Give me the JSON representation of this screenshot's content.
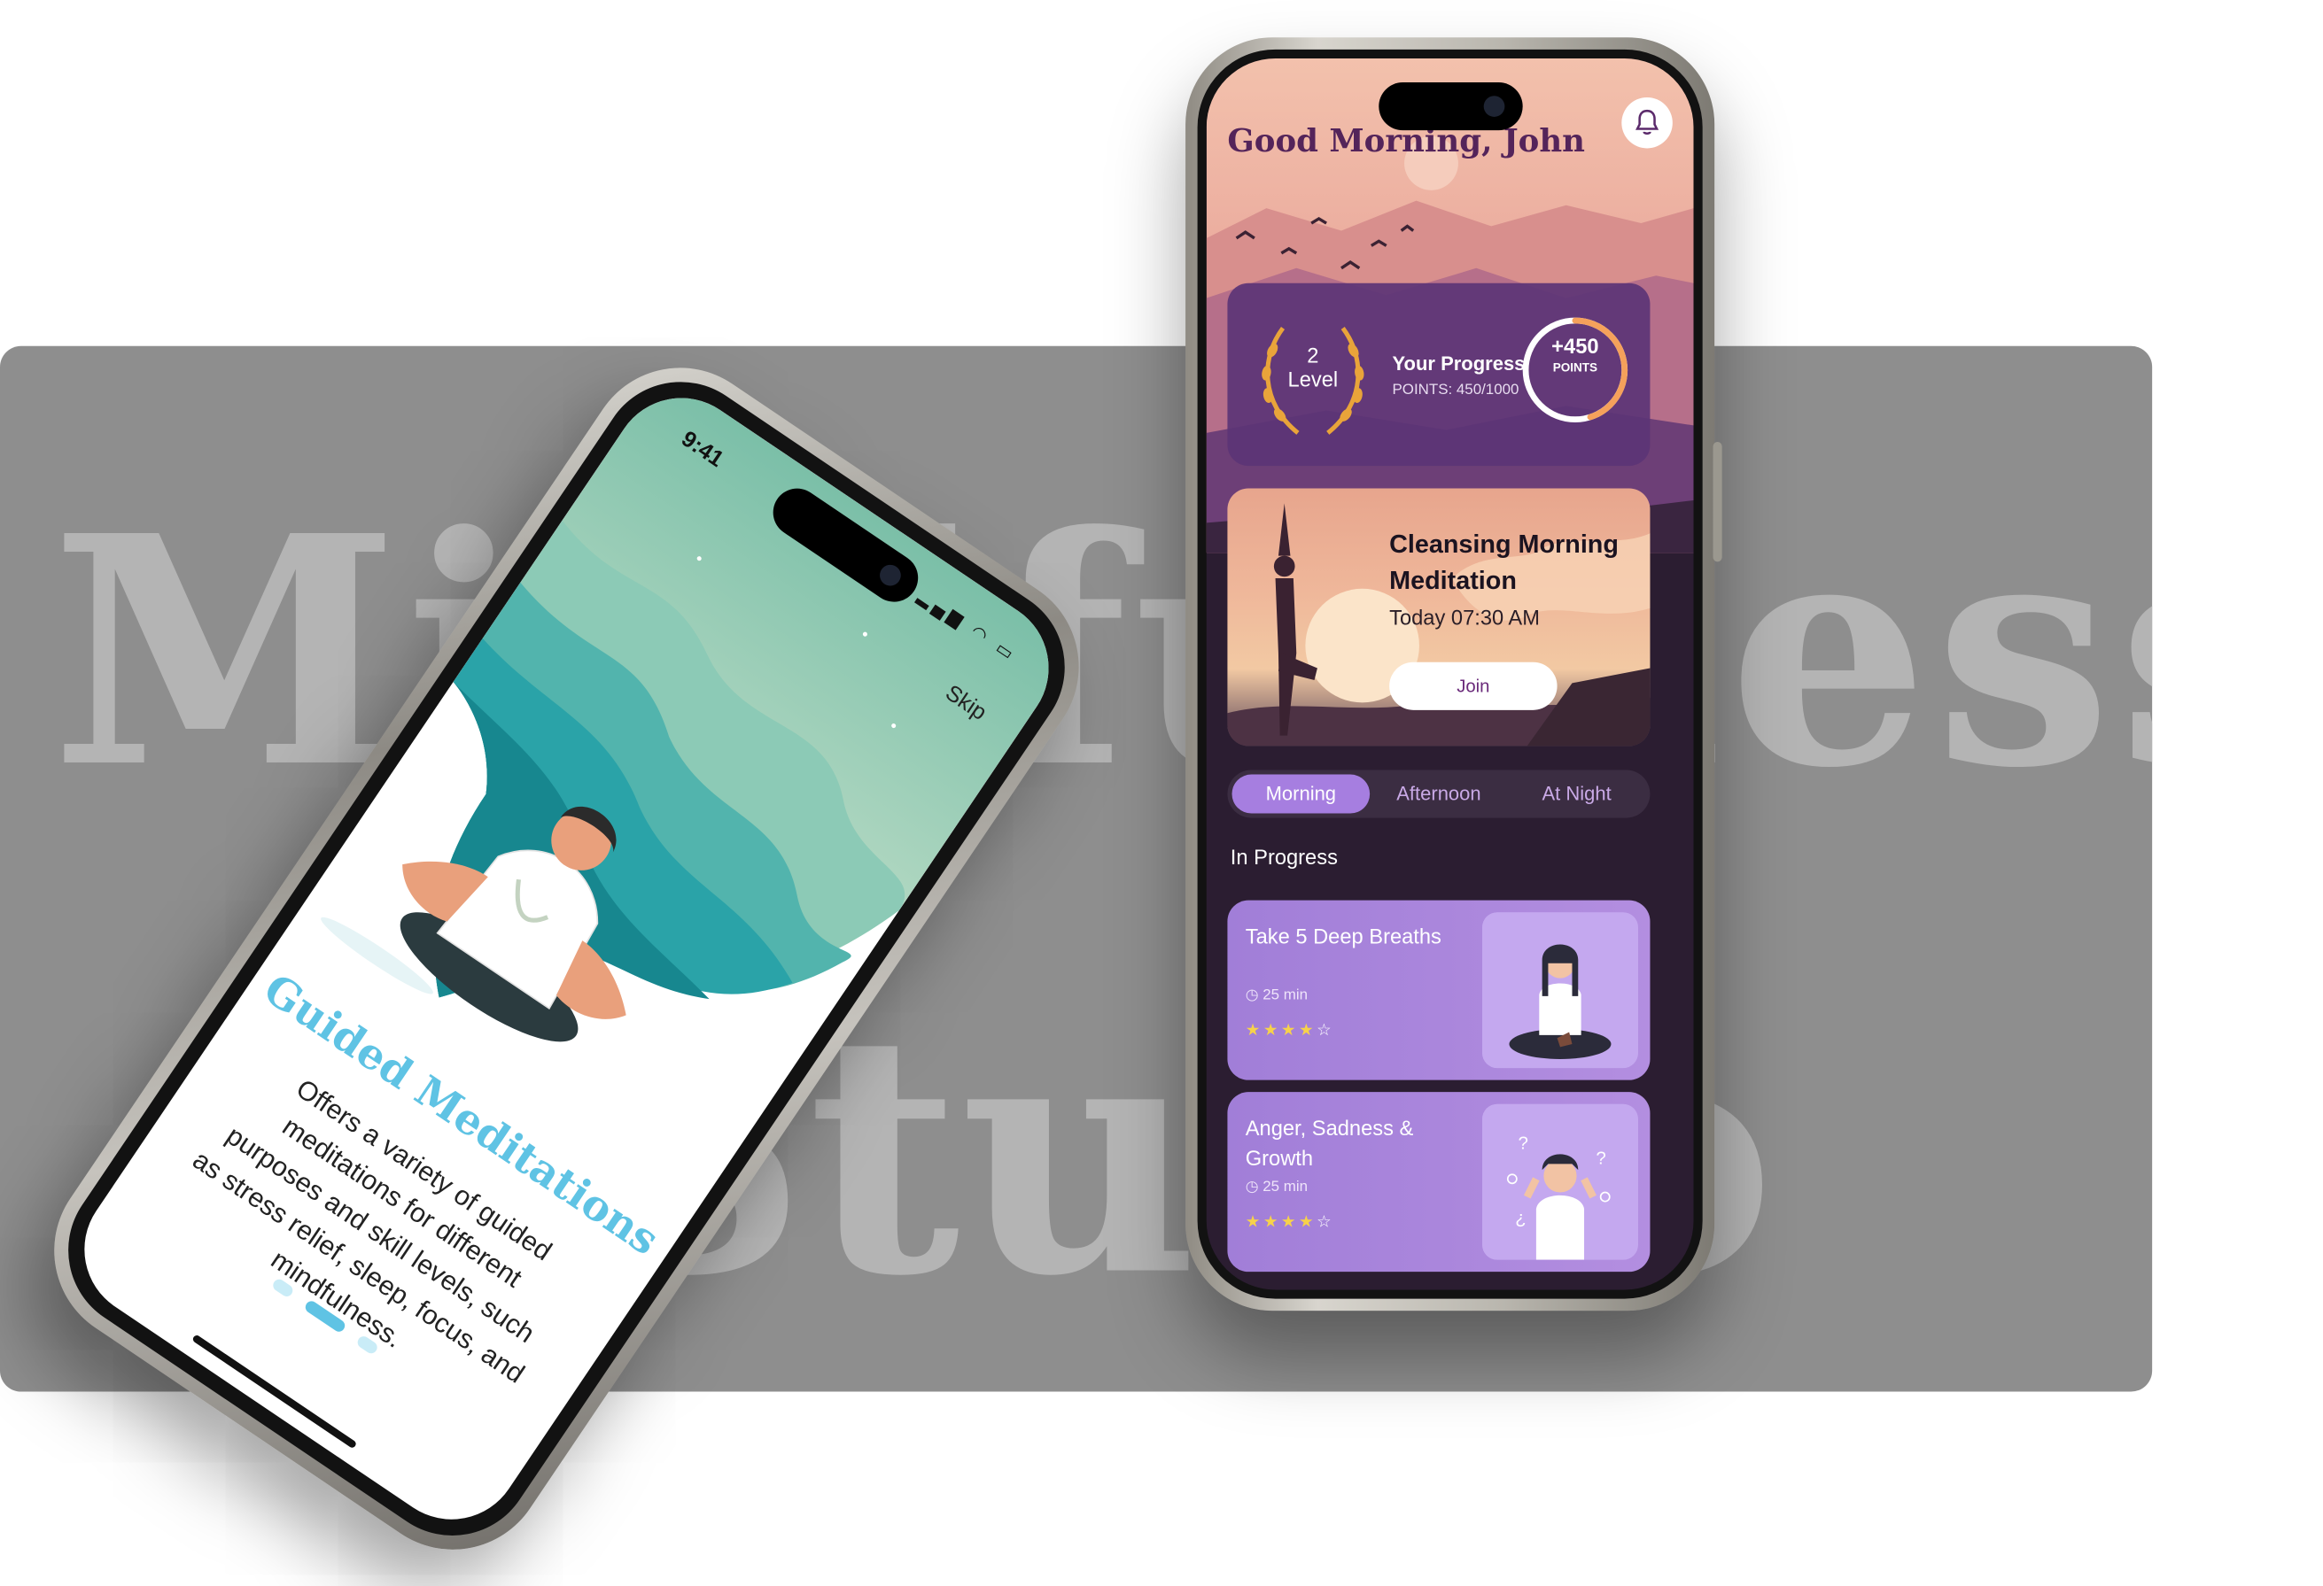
{
  "background": {
    "word_top": "Mindfulness",
    "word_bottom": "Studio"
  },
  "onboarding": {
    "status_time": "9:41",
    "skip_label": "Skip",
    "title": "Guided Meditations",
    "body": "Offers a variety of guided meditations for different purposes and skill levels, such as stress relief, sleep, focus, and mindfulness.",
    "page_count": 3,
    "active_page": 2,
    "colors": {
      "accent": "#5fc3e4",
      "teal": "#2aa3a8"
    }
  },
  "home": {
    "greeting": "Good Morning, John",
    "level": {
      "number": "2",
      "label": "Level"
    },
    "progress": {
      "title": "Your Progress",
      "points_text": "POINTS: 450/1000",
      "points_value": 450,
      "points_max": 1000,
      "badge_value": "+450",
      "badge_label": "POINTS"
    },
    "session": {
      "title": "Cleansing Morning Meditation",
      "time": "Today 07:30 AM",
      "join_label": "Join"
    },
    "tabs": [
      {
        "label": "Morning",
        "active": true
      },
      {
        "label": "Afternoon",
        "active": false
      },
      {
        "label": "At Night",
        "active": false
      }
    ],
    "section_title": "In Progress",
    "items": [
      {
        "title": "Take 5 Deep Breaths",
        "duration": "25 min",
        "rating": 4,
        "max_rating": 5
      },
      {
        "title": "Anger, Sadness & Growth",
        "duration": "25 min",
        "rating": 4,
        "max_rating": 5
      }
    ],
    "colors": {
      "card_purple": "#a17ed8",
      "tab_active": "#a67ee0",
      "ring": "#f5a15b"
    }
  }
}
